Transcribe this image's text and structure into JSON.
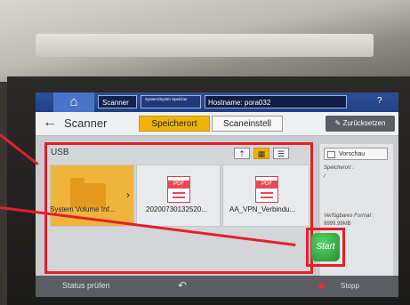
{
  "statusbar": {
    "home_icon": "home-icon",
    "app_tab": "Scanner",
    "tiny_tab": "System/Systm Speicher",
    "hostname": "Hostname: pora032"
  },
  "header": {
    "title": "Scanner",
    "tab_speicherort": "Speicherort",
    "tab_scaneinstell": "Scaneinstell",
    "reset_label": "Zurücksetzen"
  },
  "usb": {
    "label": "USB",
    "files": [
      {
        "name": "System Volume Inf...",
        "type": "folder"
      },
      {
        "name": "20200730132520...",
        "type": "pdf"
      },
      {
        "name": "AA_VPN_Verbindu...",
        "type": "pdf"
      }
    ],
    "pdf_badge": "PDF"
  },
  "side": {
    "vorschau": "Vorschau",
    "speicherort_label": "Speicherort :",
    "speicherort_value": "/",
    "format_label": "Verfügbares Format :",
    "format_value": "9999.99MB"
  },
  "start_label": "Start",
  "bottombar": {
    "status_check": "Status prüfen",
    "stop": "Stopp"
  },
  "colors": {
    "accent": "#f0b400",
    "highlight": "#e2202a",
    "start": "#2fae3f"
  }
}
